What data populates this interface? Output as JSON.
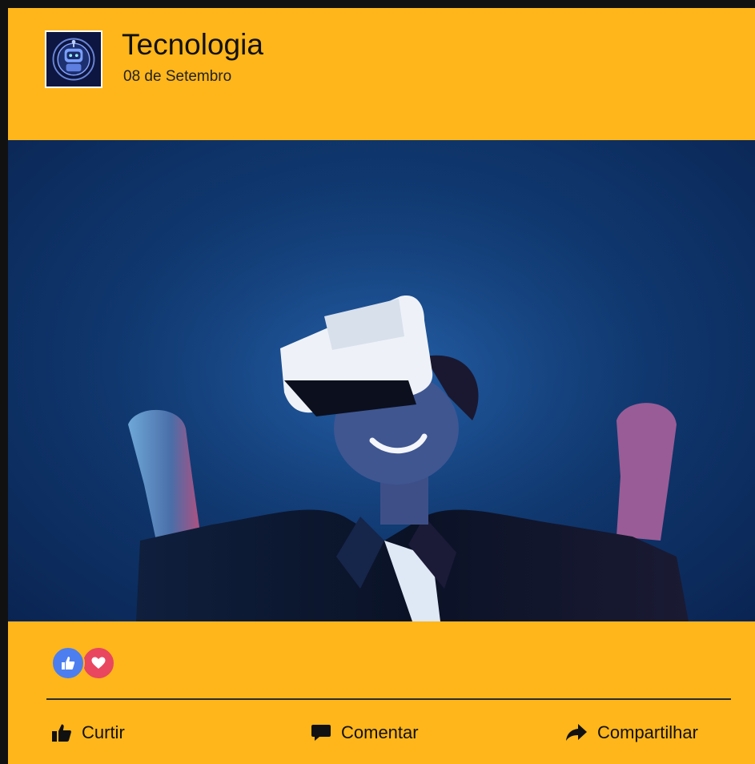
{
  "post": {
    "page_name": "Tecnologia",
    "date": "08 de Setembro",
    "avatar_icon": "robot-icon",
    "image_icon": "vr-headset-person-photo"
  },
  "reactions": {
    "types": [
      "like",
      "love"
    ],
    "like_color": "#4d7ef0",
    "love_color": "#e8475f"
  },
  "actions": {
    "like_label": "Curtir",
    "comment_label": "Comentar",
    "share_label": "Compartilhar"
  },
  "colors": {
    "card_background": "#FFB61A",
    "photo_background": "#103a72",
    "frame": "#111111"
  }
}
